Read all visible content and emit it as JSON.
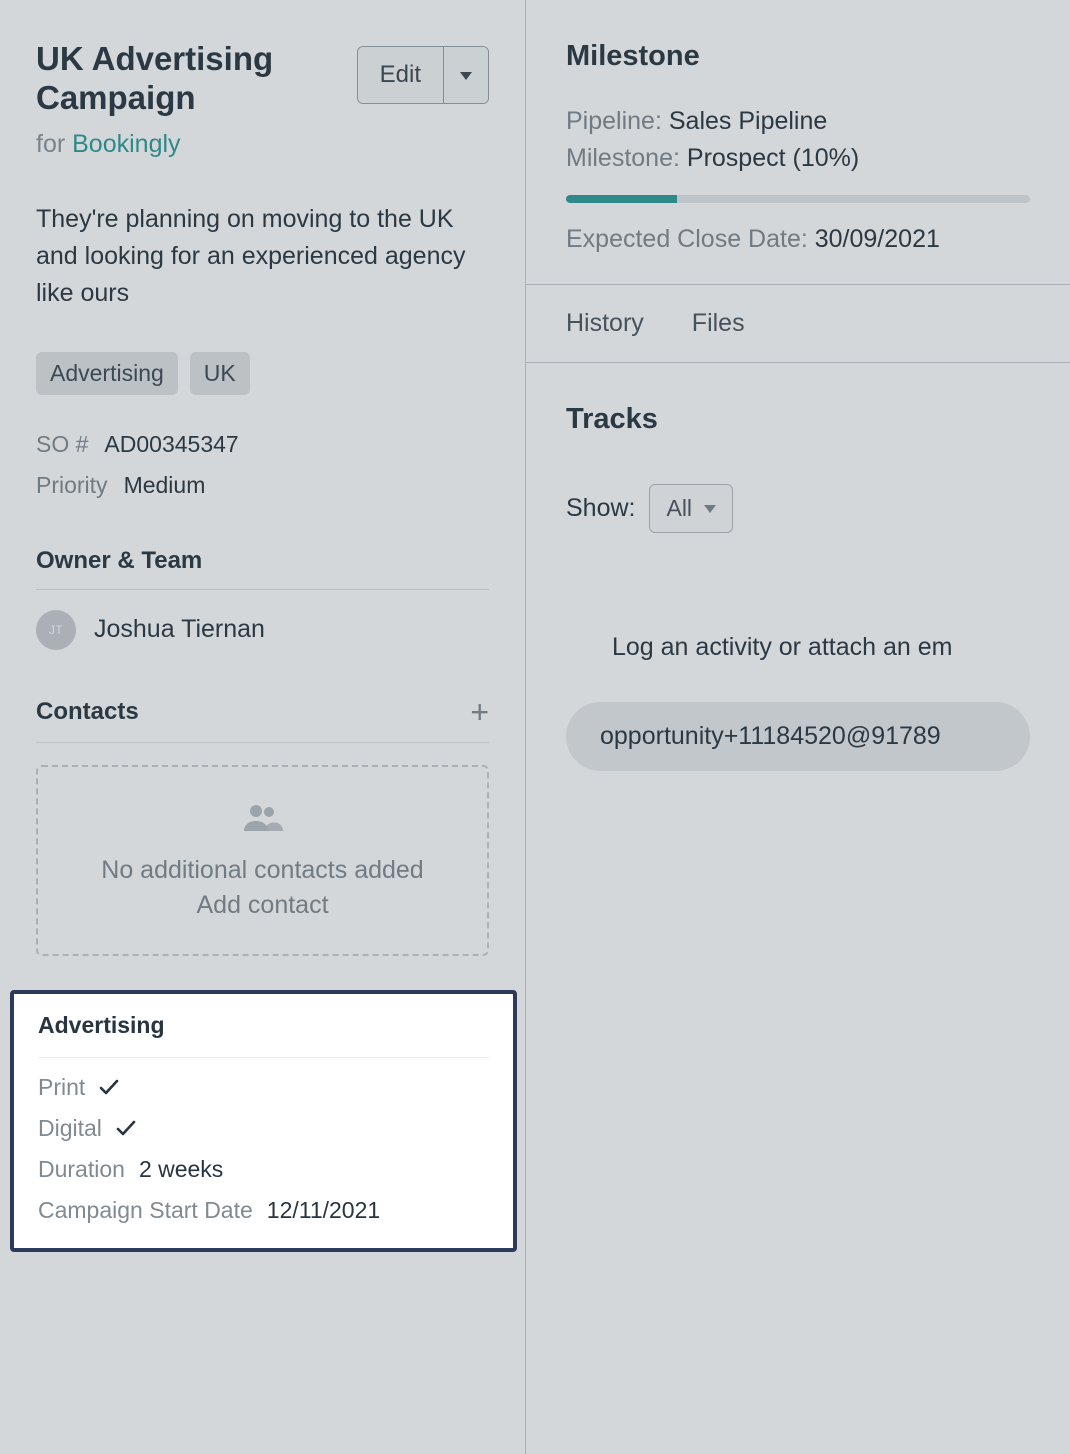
{
  "header": {
    "title": "UK Advertising Campaign",
    "for_label": "for ",
    "org_name": "Bookingly",
    "edit_label": "Edit"
  },
  "description": "They're planning on moving to the UK and looking for an experienced agency like ours",
  "tags": [
    "Advertising",
    "UK"
  ],
  "meta": {
    "so_label": "SO #",
    "so_value": "AD00345347",
    "priority_label": "Priority",
    "priority_value": "Medium"
  },
  "owner": {
    "section": "Owner & Team",
    "initials": "JT",
    "name": "Joshua Tiernan"
  },
  "contacts": {
    "section": "Contacts",
    "empty_msg": "No additional contacts added",
    "add_label": "Add contact"
  },
  "advertising": {
    "section": "Advertising",
    "rows": {
      "print_label": "Print",
      "digital_label": "Digital",
      "duration_label": "Duration",
      "duration_value": "2 weeks",
      "start_label": "Campaign Start Date",
      "start_value": "12/11/2021"
    }
  },
  "milestone": {
    "title": "Milestone",
    "pipeline_label": "Pipeline: ",
    "pipeline_value": "Sales Pipeline",
    "milestone_label": "Milestone: ",
    "milestone_value": "Prospect (10%)",
    "progress_pct": 24,
    "expected_label": "Expected Close Date: ",
    "expected_value": "30/09/2021"
  },
  "tabs": {
    "history": "History",
    "files": "Files"
  },
  "tracks": {
    "title": "Tracks",
    "show_label": "Show:",
    "show_value": "All",
    "log_text": "Log an activity or attach an em",
    "email": "opportunity+11184520@91789"
  }
}
